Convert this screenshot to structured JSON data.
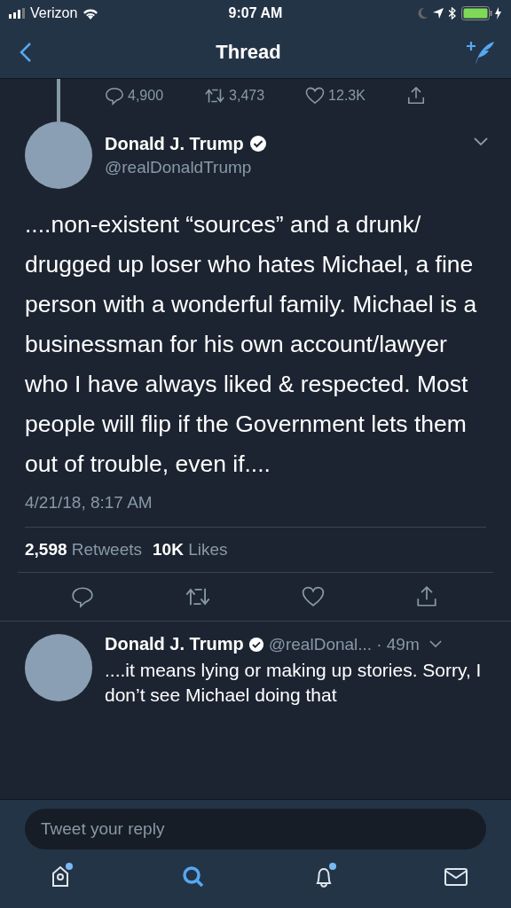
{
  "status_bar": {
    "carrier": "Verizon",
    "time": "9:07 AM"
  },
  "nav": {
    "title": "Thread"
  },
  "previous_tweet_actions": {
    "replies": "4,900",
    "retweets": "3,473",
    "likes": "12.3K"
  },
  "main_tweet": {
    "name": "Donald J. Trump",
    "verified": true,
    "handle": "@realDonaldTrump",
    "text": "....non-existent “sources” and a drunk/ drugged up loser who hates Michael, a fine person with a wonderful family. Michael is a businessman for his own account/lawyer who I have always liked & respected. Most people will flip if the Government lets them out of trouble, even if....",
    "timestamp": "4/21/18, 8:17 AM",
    "retweet_count": "2,598",
    "retweets_label": "Retweets",
    "like_count": "10K",
    "likes_label": "Likes"
  },
  "reply_tweet": {
    "name": "Donald J. Trump",
    "verified": true,
    "handle": "@realDonal...",
    "time": "· 49m",
    "text": "....it means lying or making up stories. Sorry, I don’t see Michael doing that"
  },
  "reply_field": {
    "placeholder": "Tweet your reply"
  },
  "tab_bar": [
    {
      "kind": "home",
      "selected": false,
      "unread": true
    },
    {
      "kind": "search",
      "selected": true,
      "unread": false
    },
    {
      "kind": "notifications",
      "selected": false,
      "unread": true
    },
    {
      "kind": "messages",
      "selected": false,
      "unread": false
    }
  ]
}
